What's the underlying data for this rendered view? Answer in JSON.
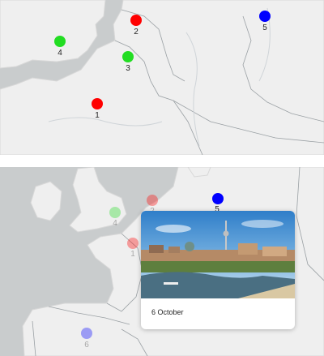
{
  "top_map": {
    "markers": [
      {
        "label": "1",
        "color": "#ff0000"
      },
      {
        "label": "2",
        "color": "#ff0000"
      },
      {
        "label": "3",
        "color": "#22dd22"
      },
      {
        "label": "4",
        "color": "#22dd22"
      },
      {
        "label": "5",
        "color": "#0000ff"
      }
    ]
  },
  "bottom_map": {
    "markers": [
      {
        "label": "1",
        "color": "#ff0000",
        "faded": true
      },
      {
        "label": "2",
        "color": "#ff0000",
        "faded": true
      },
      {
        "label": "4",
        "color": "#22dd22",
        "faded": true
      },
      {
        "label": "5",
        "color": "#0000ff",
        "faded": false
      },
      {
        "label": "6",
        "color": "#0000ff",
        "faded": true
      }
    ],
    "popup": {
      "caption": "6 October",
      "photo_icon": "berlin-skyline-photo"
    }
  },
  "colors": {
    "land": "#efefef",
    "water": "#c9cccd",
    "border": "#9aa0a4"
  }
}
